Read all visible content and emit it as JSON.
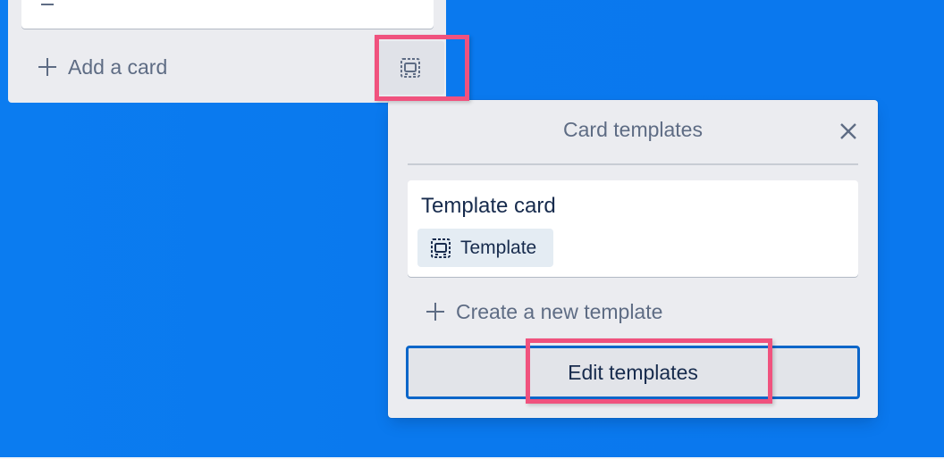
{
  "list": {
    "add_card_label": "Add a card"
  },
  "popover": {
    "title": "Card templates",
    "template_card": {
      "title": "Template card",
      "badge_label": "Template"
    },
    "create_label": "Create a new template",
    "edit_label": "Edit templates"
  },
  "icons": {
    "description": "description-icon",
    "plus": "plus-icon",
    "template": "template-icon",
    "close": "close-icon"
  },
  "colors": {
    "board_background": "#0a79ee",
    "list_background": "#ebecf0",
    "highlight": "#f0527e",
    "edit_button_border": "#0c66c9",
    "text_primary": "#172b4d",
    "text_secondary": "#5e6c84"
  }
}
